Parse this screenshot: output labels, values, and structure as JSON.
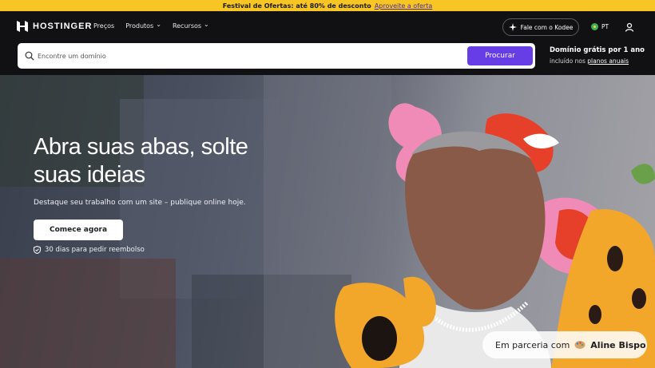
{
  "promo": {
    "text": "Festival de Ofertas: até 80% de desconto",
    "link": "Aproveite a oferta"
  },
  "header": {
    "brand": "HOSTINGER",
    "nav": [
      {
        "label": "Preços"
      },
      {
        "label": "Produtos"
      },
      {
        "label": "Recursos"
      }
    ],
    "kodee_label": "Fale com o Kodee",
    "lang": "PT"
  },
  "search": {
    "placeholder": "Encontre um domínio",
    "button": "Procurar",
    "promo_title": "Domínio grátis por 1 ano",
    "promo_prefix": "incluído nos",
    "promo_link": "planos anuais"
  },
  "hero": {
    "title": "Abra suas abas, solte suas ideias",
    "subtitle": "Destaque seu trabalho com um site – publique online hoje.",
    "cta": "Comece agora",
    "refund": "30 dias para pedir reembolso",
    "partner_prefix": "Em parceria com",
    "partner_name": "Aline Bispo"
  },
  "colors": {
    "accent": "#673de6",
    "promo_bg": "#f7c524",
    "header_bg": "#111114"
  }
}
